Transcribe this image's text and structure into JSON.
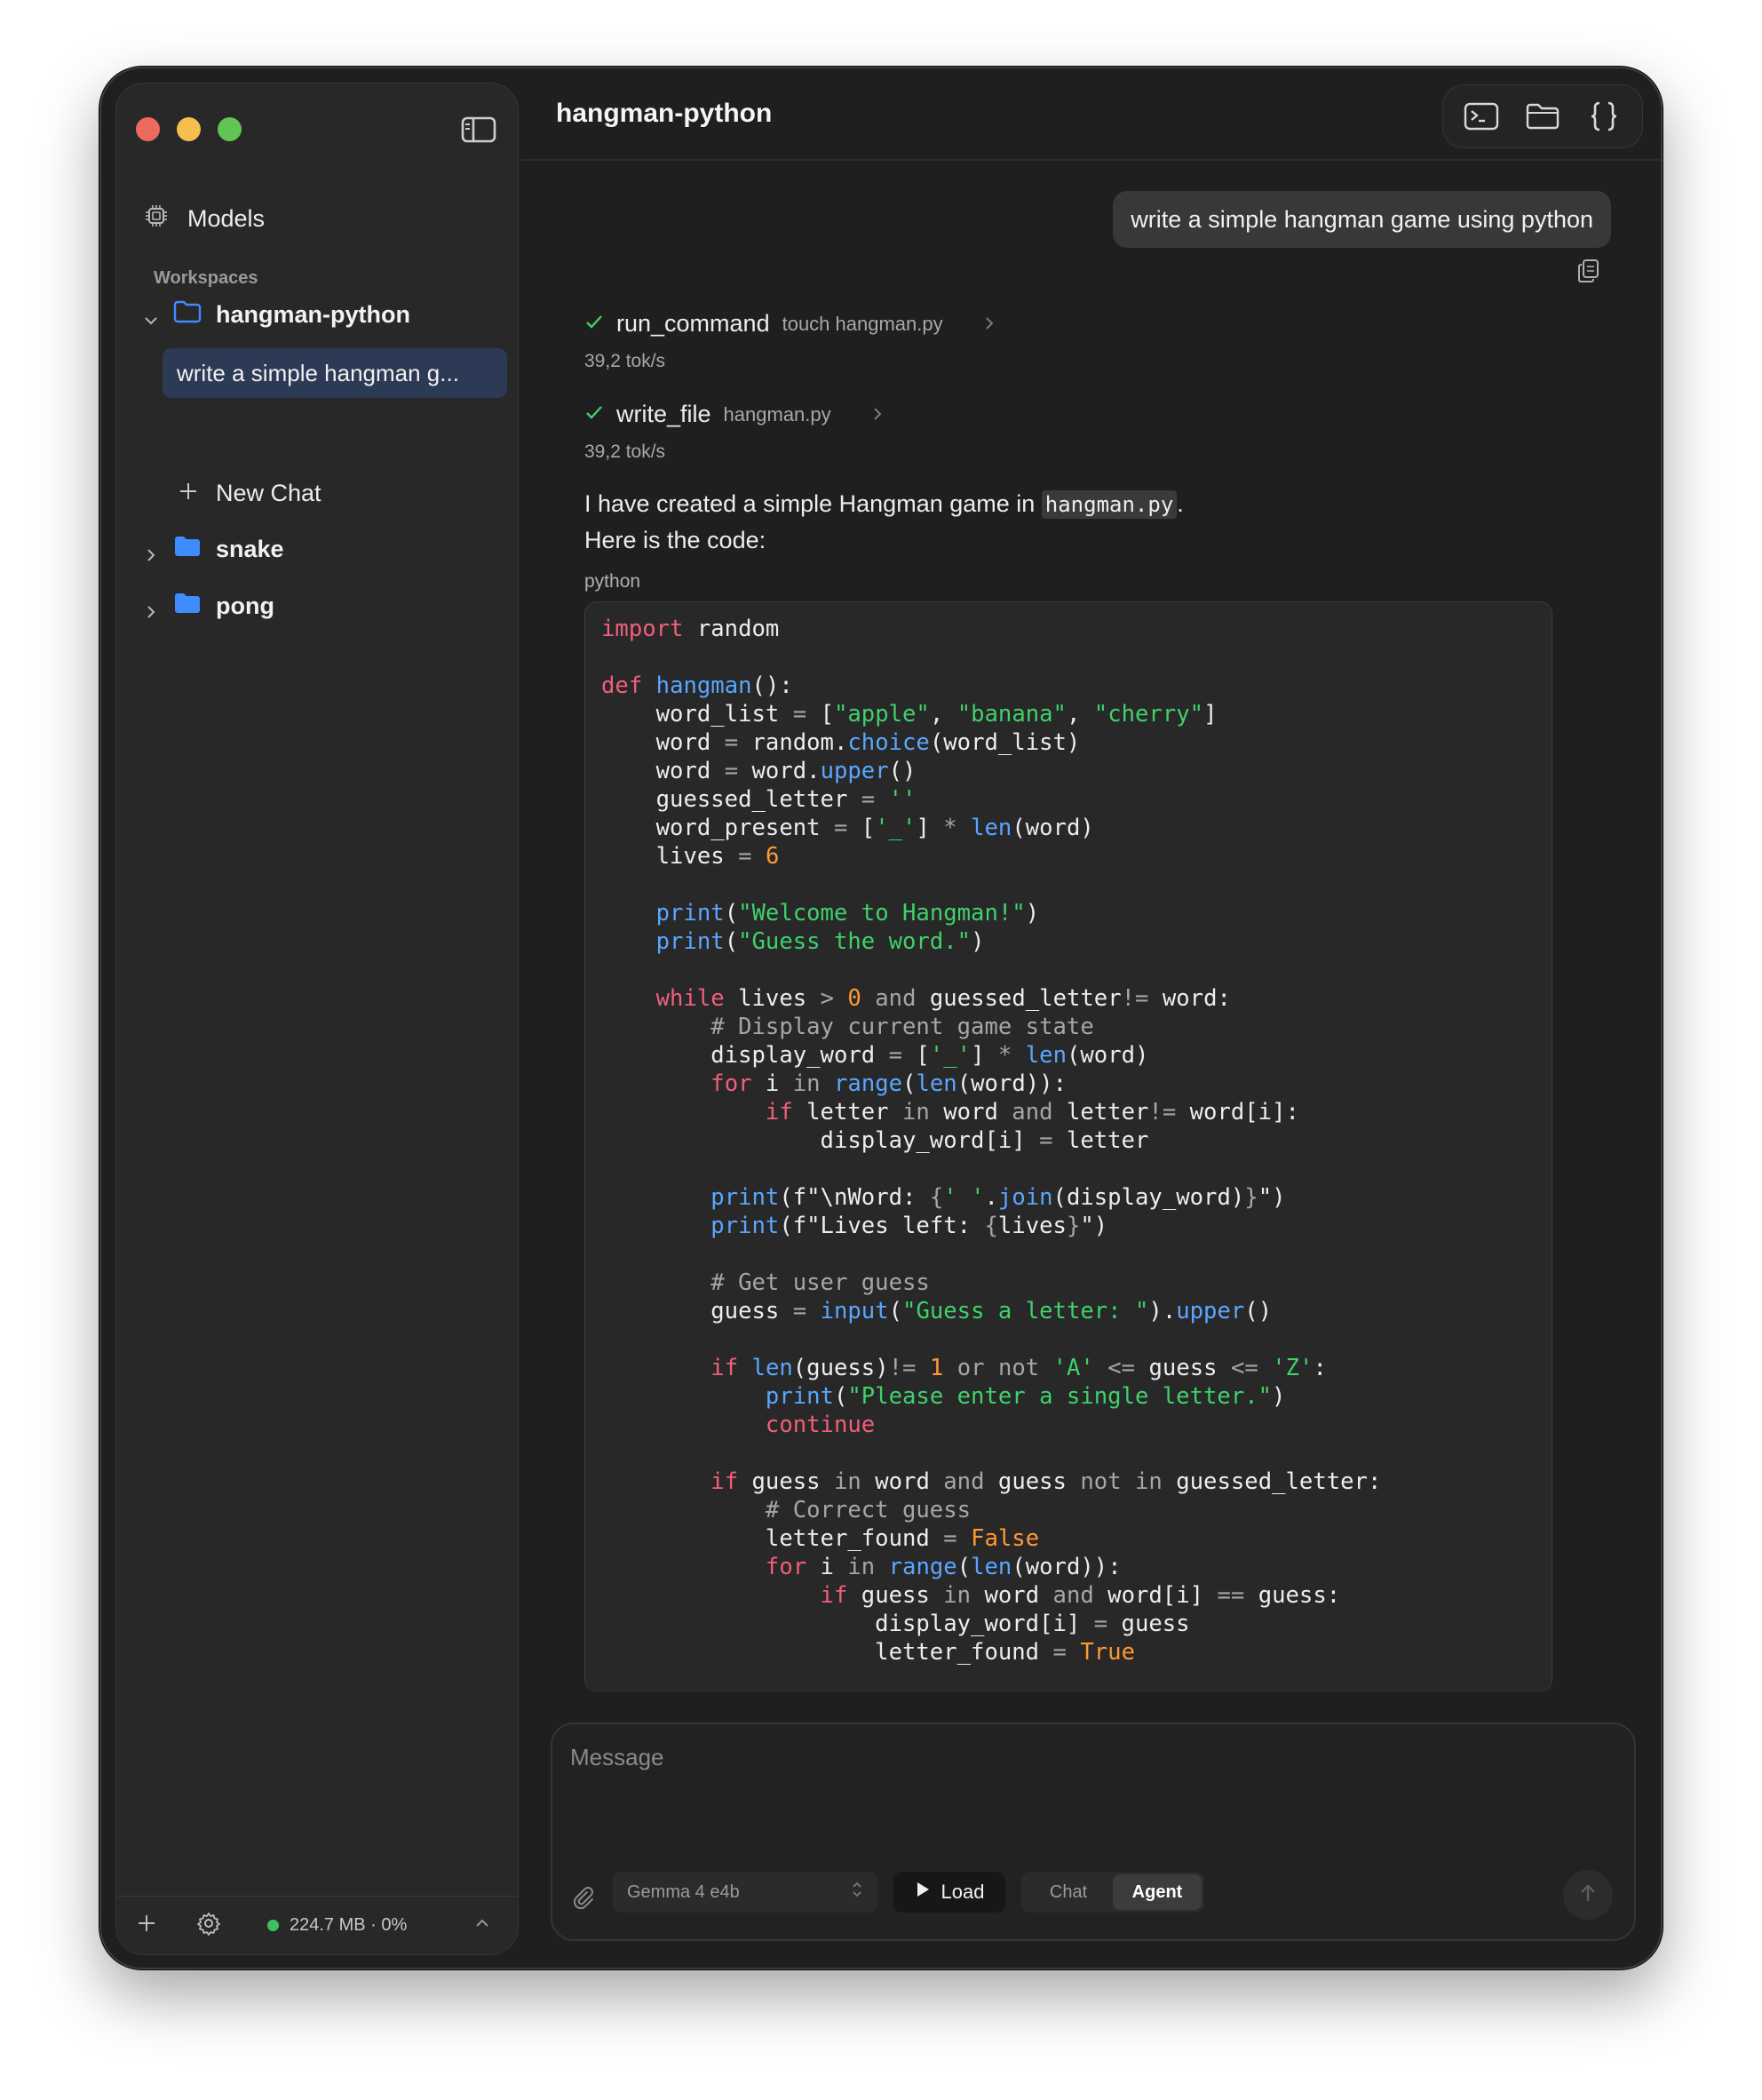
{
  "sidebar": {
    "models_label": "Models",
    "workspaces_label": "Workspaces",
    "workspaces": [
      {
        "name": "hangman-python",
        "expanded": true
      },
      {
        "name": "snake",
        "expanded": false
      },
      {
        "name": "pong",
        "expanded": false
      }
    ],
    "active_chat": "write a simple hangman g...",
    "new_chat_label": "New Chat",
    "status": "224.7 MB · 0%"
  },
  "header": {
    "title": "hangman-python"
  },
  "conversation": {
    "user_message": "write a simple hangman game using python",
    "tool_calls": [
      {
        "name": "run_command",
        "arg": "touch hangman.py",
        "speed": "39,2 tok/s"
      },
      {
        "name": "write_file",
        "arg": "hangman.py",
        "speed": "39,2 tok/s"
      }
    ],
    "reply_line1_before": "I have created a simple Hangman game in ",
    "reply_line1_code": "hangman.py",
    "reply_line1_after": ".",
    "reply_line2": "Here is the code:",
    "code_language": "python"
  },
  "composer": {
    "placeholder": "Message",
    "model": "Gemma 4 e4b",
    "load_label": "Load",
    "mode_chat": "Chat",
    "mode_agent": "Agent",
    "active_mode": "Agent"
  },
  "colors": {
    "keyword": "#ef5f7a",
    "function": "#5aa6ff",
    "string": "#3fd16b",
    "number": "#ff9933",
    "comment": "#a6a6a6",
    "selection": "#2c3a55",
    "status_online": "#3fc060"
  }
}
